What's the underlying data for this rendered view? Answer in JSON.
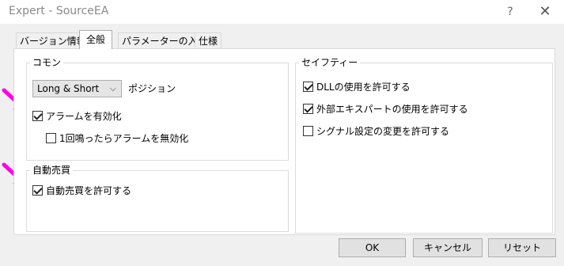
{
  "window": {
    "title": "Expert - SourceEA",
    "help_label": "?",
    "close_label": "✕"
  },
  "tabs": [
    {
      "label": "バージョン情報",
      "active": false
    },
    {
      "label": "全般",
      "active": true
    },
    {
      "label": "パラメーターの入力",
      "active": false
    },
    {
      "label": "仕様",
      "active": false
    }
  ],
  "common": {
    "title": "コモン",
    "position_select": {
      "value": "Long & Short",
      "arrow": "⌵"
    },
    "position_label": "ポジション",
    "alert_enable": {
      "label": "アラームを有効化",
      "checked": true
    },
    "alert_once": {
      "label": "1回鳴ったらアラームを無効化",
      "checked": false
    }
  },
  "auto_trade": {
    "title": "自動売買",
    "allow": {
      "label": "自動売買を許可する",
      "checked": true
    }
  },
  "safety": {
    "title": "セイフティー",
    "allow_dll": {
      "label": "DLLの使用を許可する",
      "checked": true
    },
    "allow_external": {
      "label": "外部エキスパートの使用を許可する",
      "checked": true
    },
    "allow_signal": {
      "label": "シグナル設定の変更を許可する",
      "checked": false
    }
  },
  "buttons": {
    "ok": "OK",
    "cancel": "キャンセル",
    "reset": "リセット"
  },
  "annotations": {
    "arrow_color": "#ff00e6"
  }
}
